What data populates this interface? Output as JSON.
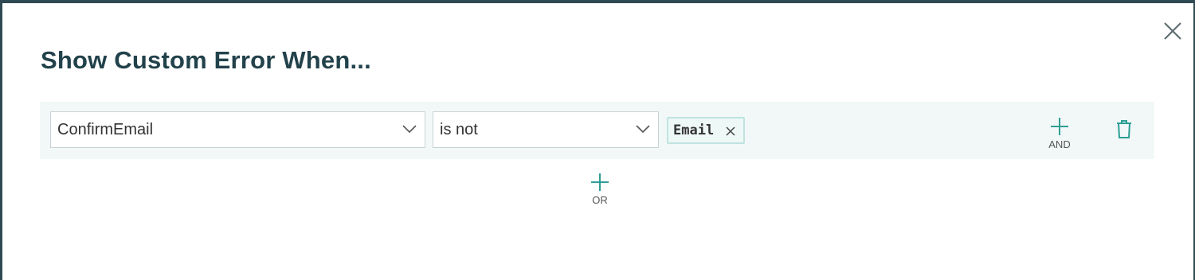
{
  "dialog": {
    "title": "Show Custom Error When..."
  },
  "rule": {
    "field_value": "ConfirmEmail",
    "operator_value": "is not",
    "tags": [
      "Email"
    ],
    "and_label": "AND"
  },
  "or_label": "OR",
  "colors": {
    "accent": "#2e9e94",
    "title": "#22424b",
    "row_background": "#f2f8f8",
    "backdrop": "#2f4a52"
  },
  "icons": {
    "close": "close-icon",
    "dropdown": "chevron-down-icon",
    "tag_remove": "close-icon",
    "add": "plus-icon",
    "delete": "trash-icon"
  }
}
